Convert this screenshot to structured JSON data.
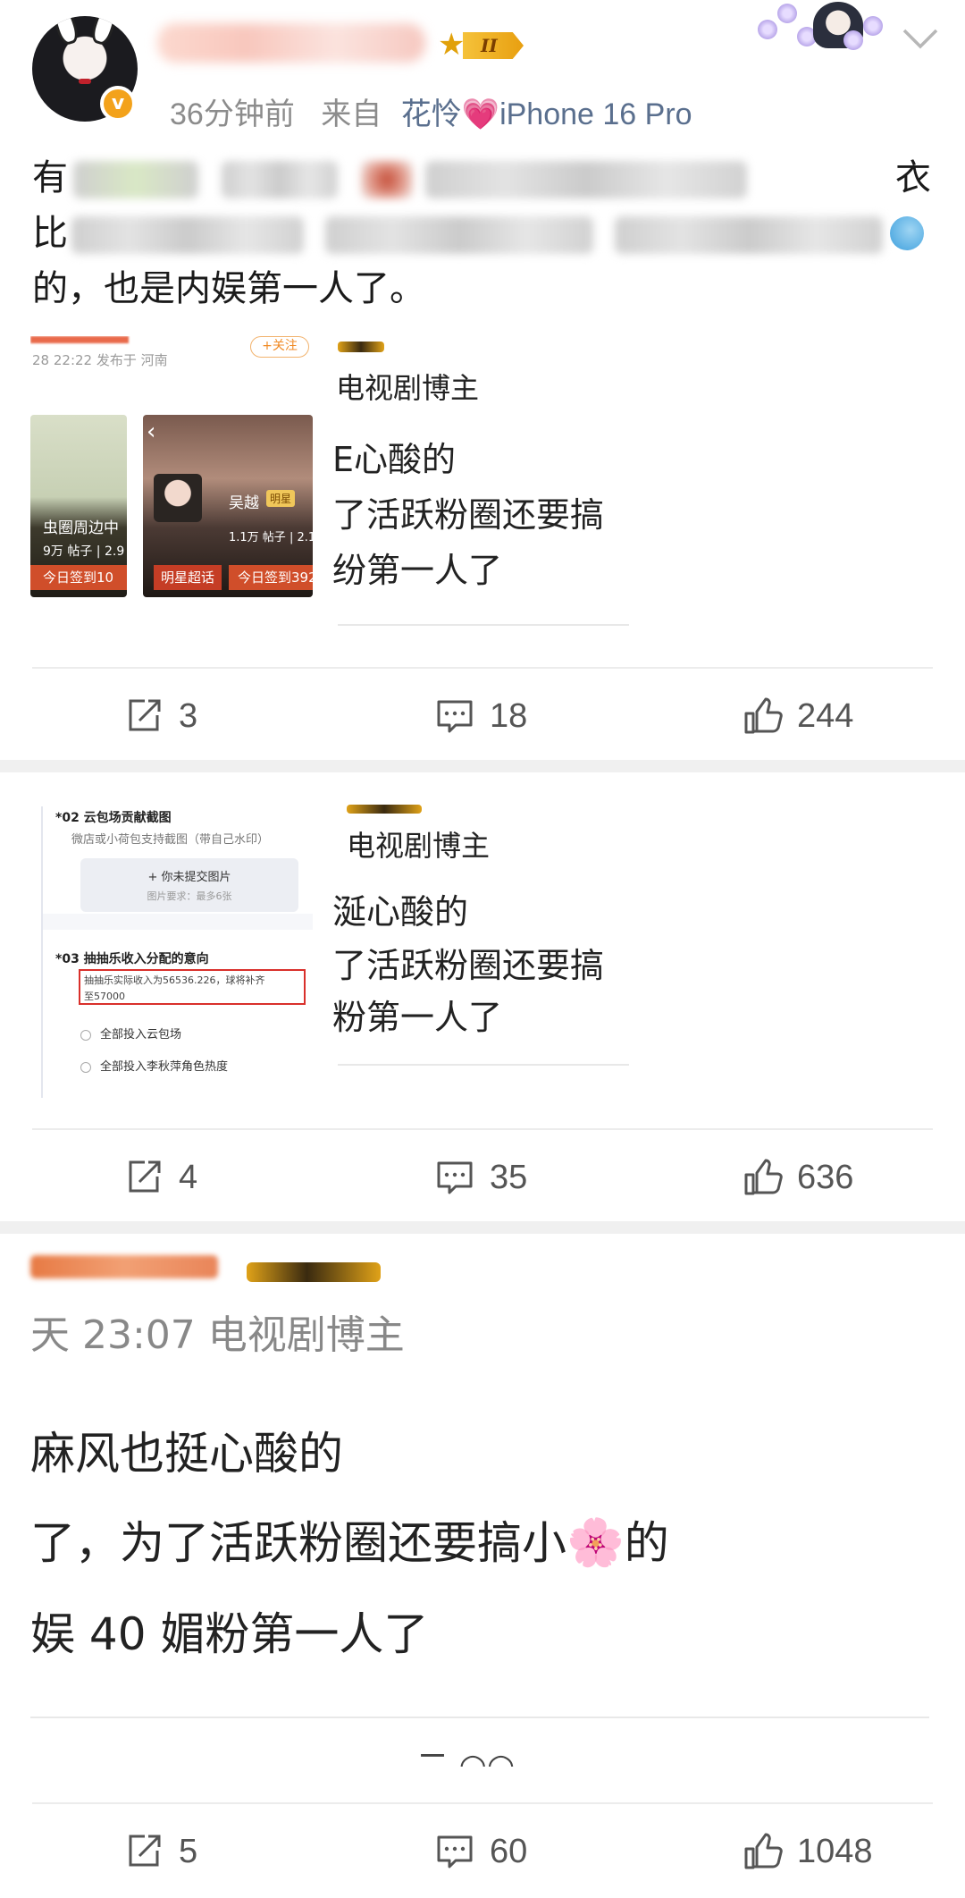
{
  "header": {
    "time": "36分钟前",
    "from_label": "来自",
    "device_name": "花怜",
    "device_heart": "💗",
    "device_model": "iPhone 16 Pro",
    "level": "II",
    "verified_mark": "v"
  },
  "post": {
    "line1_start": "有",
    "line1_end": "衣",
    "line2_start": "比",
    "line3": "的，也是内娱第一人了。"
  },
  "collage1": {
    "time": "28 22:22 发布于 河南",
    "follow": "+关注",
    "role": "电视剧博主",
    "text_lines": [
      "E心酸的",
      "了活跃粉圈还要搞",
      "纷第一人了"
    ],
    "tile_a": {
      "name": "虫圈周边中",
      "stat": "9万 帖子 | 2.9",
      "sign": "今日签到10"
    },
    "tile_b": {
      "name": "吴越",
      "tag": "明星",
      "stat": "1.1万 帖子 | 2.1",
      "sign_left": "明星超话",
      "sign": "今日签到392"
    }
  },
  "actions1": {
    "share": "3",
    "comment": "18",
    "like": "244"
  },
  "collage2": {
    "role": "电视剧博主",
    "text_lines": [
      "涎心酸的",
      "了活跃粉圈还要搞",
      "粉第一人了"
    ],
    "form": {
      "q2_title": "*02 云包场贡献截图",
      "q2_hint": "微店或小荷包支持截图（带自己水印）",
      "upload_label": "+ 你未提交图片",
      "upload_hint": "图片要求：最多6张",
      "q3_title": "*03 抽抽乐收入分配的意向",
      "q3_note_line1": "抽抽乐实际收入为56536.226，球将补齐",
      "q3_note_line2": "至57000",
      "option1": "全部投入云包场",
      "option2": "全部投入李秋萍角色热度"
    }
  },
  "actions2": {
    "share": "4",
    "comment": "35",
    "like": "636"
  },
  "collage3": {
    "time_line": "天 23:07  电视剧博主",
    "text_lines": [
      "麻风也挺心酸的",
      "了，为了活跃粉圈还要搞小",
      "娱 40 媚粉第一人了"
    ],
    "flower_emoji": "🌸",
    "after_flower": "的",
    "cut_counts": "二  ○○"
  },
  "actions3": {
    "share": "5",
    "comment": "60",
    "like": "1048"
  },
  "colors": {
    "section_gap": "#f0f0f0",
    "meta_gray": "#8c8c8c",
    "device_blue": "#5a6f8e",
    "badge_orange": "#f3a21b"
  },
  "icons": [
    "share-icon",
    "comment-icon",
    "like-icon",
    "chevron-down-icon",
    "verified-icon",
    "level-star-icon"
  ]
}
